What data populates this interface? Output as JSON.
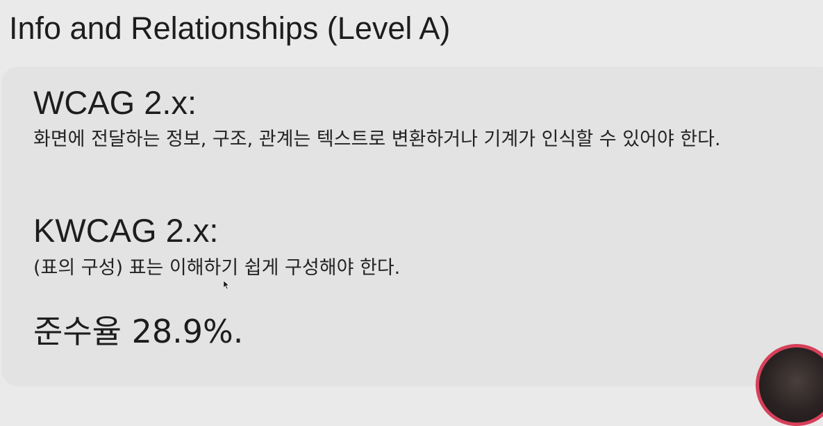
{
  "slide": {
    "title": "Info and Relationships (Level A)"
  },
  "wcag": {
    "heading": "WCAG 2.x:",
    "description": "화면에 전달하는 정보, 구조, 관계는 텍스트로 변환하거나 기계가 인식할 수 있어야 한다."
  },
  "kwcag": {
    "heading": "KWCAG 2.x:",
    "description": "(표의 구성) 표는 이해하기 쉽게 구성해야 한다."
  },
  "compliance": {
    "text": "준수율 28.9%."
  },
  "icons": {
    "cursor": "mouse-pointer-icon",
    "avatar": "presenter-video-avatar"
  },
  "colors": {
    "background": "#eaeaea",
    "card": "#e3e3e3",
    "avatar_ring": "#d6405a"
  }
}
